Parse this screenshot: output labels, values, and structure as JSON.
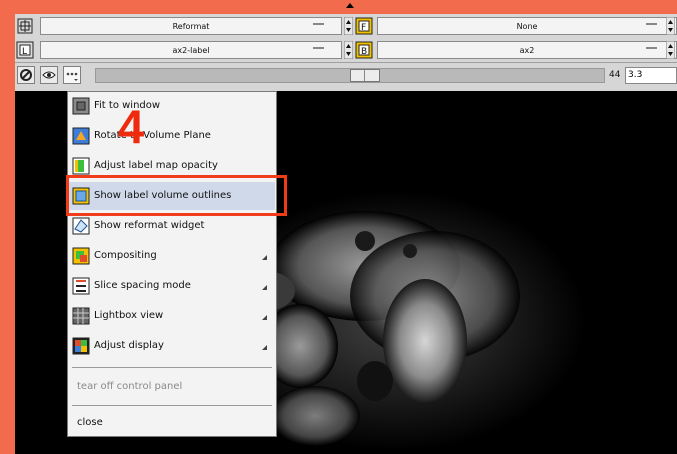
{
  "colors": {
    "frame_red": "#f26b4c",
    "highlight_red": "#f03c1a",
    "menu_bg": "#f3f3f3",
    "menu_hover": "#cfd9ea"
  },
  "slice_controls": {
    "row1": {
      "left_value": "Reformat",
      "right_value": "None"
    },
    "row2": {
      "left_value": "ax2-label",
      "right_value": "ax2"
    },
    "row3": {
      "slice_number": "44",
      "slice_offset": "3.3"
    }
  },
  "step_marker": "4",
  "menu": {
    "items": [
      {
        "label": "Fit to window",
        "icon": "fit-window-icon",
        "submenu": false
      },
      {
        "label": "Rotate to Volume Plane",
        "icon": "rotate-plane-icon",
        "submenu": false
      },
      {
        "label": "Adjust label map opacity",
        "icon": "label-opacity-icon",
        "submenu": false
      },
      {
        "label": "Show label volume outlines",
        "icon": "label-outline-icon",
        "submenu": false,
        "highlighted": true
      },
      {
        "label": "Show reformat widget",
        "icon": "reformat-widget-icon",
        "submenu": false
      },
      {
        "label": "Compositing",
        "icon": "compositing-icon",
        "submenu": true
      },
      {
        "label": "Slice spacing mode",
        "icon": "slice-spacing-icon",
        "submenu": true
      },
      {
        "label": "Lightbox view",
        "icon": "lightbox-icon",
        "submenu": true
      },
      {
        "label": "Adjust display",
        "icon": "adjust-display-icon",
        "submenu": true
      }
    ],
    "tear_off": "tear off control panel",
    "close": "close"
  }
}
